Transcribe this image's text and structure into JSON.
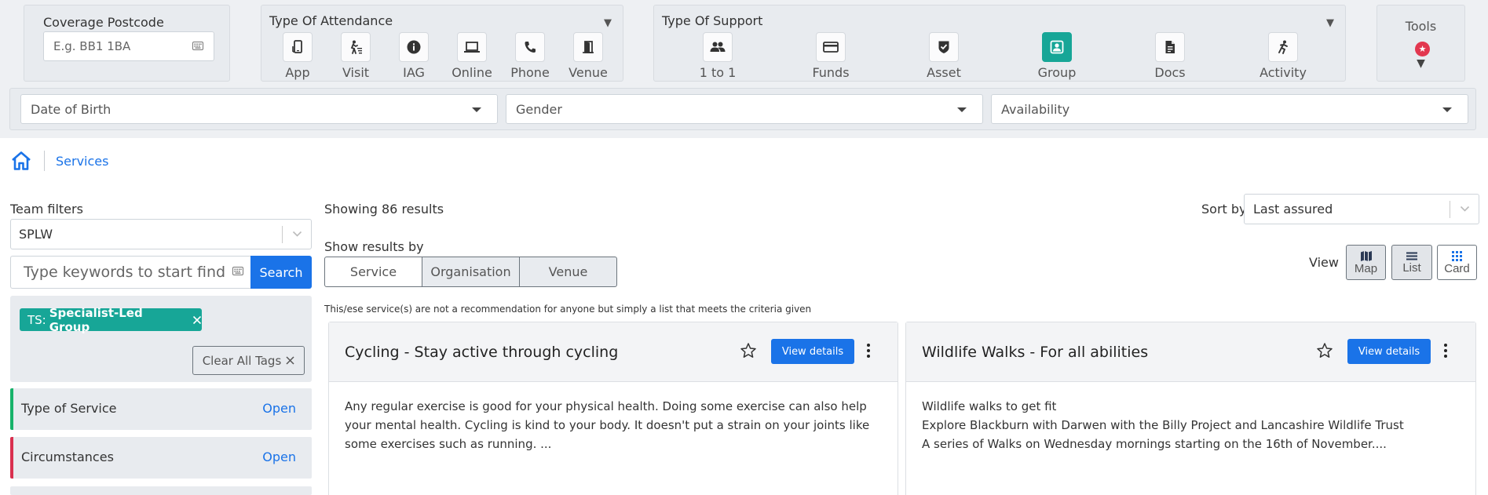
{
  "coverage": {
    "label": "Coverage Postcode",
    "placeholder": "E.g. BB1 1BA"
  },
  "attendance": {
    "label": "Type Of Attendance",
    "options": [
      {
        "label": "App",
        "icon": "mobile-icon"
      },
      {
        "label": "Visit",
        "icon": "visit-icon"
      },
      {
        "label": "IAG",
        "icon": "info-icon"
      },
      {
        "label": "Online",
        "icon": "laptop-icon"
      },
      {
        "label": "Phone",
        "icon": "phone-icon"
      },
      {
        "label": "Venue",
        "icon": "door-icon"
      }
    ]
  },
  "support": {
    "label": "Type Of Support",
    "options": [
      {
        "label": "1 to 1",
        "icon": "people-icon"
      },
      {
        "label": "Funds",
        "icon": "card-icon"
      },
      {
        "label": "Asset",
        "icon": "shield-check-icon"
      },
      {
        "label": "Group",
        "icon": "group-icon",
        "active": true
      },
      {
        "label": "Docs",
        "icon": "document-icon"
      },
      {
        "label": "Activity",
        "icon": "activity-icon"
      }
    ]
  },
  "tools": {
    "label": "Tools",
    "badge_icon": "star-icon"
  },
  "filters": {
    "dob": "Date of Birth",
    "gender": "Gender",
    "availability": "Availability"
  },
  "breadcrumb": {
    "current": "Services"
  },
  "team_filters": {
    "label": "Team filters",
    "value": "SPLW"
  },
  "search": {
    "placeholder": "Type keywords to start finding",
    "button": "Search"
  },
  "tags": {
    "chip_prefix": "TS:",
    "chip_value": "Specialist-Led Group",
    "clear_label": "Clear All Tags"
  },
  "accordion": [
    {
      "label": "Type of Service",
      "action": "Open",
      "color": "#17b26a"
    },
    {
      "label": "Circumstances",
      "action": "Open",
      "color": "#d9304f"
    }
  ],
  "results": {
    "showing": "Showing 86 results"
  },
  "sort": {
    "label": "Sort by",
    "value": "Last assured"
  },
  "show_by": {
    "label": "Show results by",
    "options": [
      "Service",
      "Organisation",
      "Venue"
    ],
    "selected": "Service"
  },
  "view": {
    "label": "View",
    "options": [
      "Map",
      "List",
      "Card"
    ],
    "active": [
      "Map",
      "List"
    ]
  },
  "disclaimer": "This/ese service(s) are not a recommendation for anyone but simply a list that meets the criteria given",
  "cards": [
    {
      "title": "Cycling - Stay active through cycling",
      "button": "View details",
      "body": [
        "Any regular exercise is good for your physical health. Doing some exercise can also help your mental health. Cycling is kind to your body. It doesn't put a strain on your joints like some exercises such as running. ..."
      ]
    },
    {
      "title": "Wildlife Walks - For all abilities",
      "button": "View details",
      "body": [
        "Wildlife walks to get fit",
        "Explore Blackburn with Darwen with the Billy Project and Lancashire Wildlife Trust",
        "A series of Walks on Wednesday mornings starting on the 16th of November...."
      ]
    }
  ],
  "colors": {
    "primary": "#1a73e8",
    "teal": "#17a697",
    "badge": "#e2374f"
  }
}
